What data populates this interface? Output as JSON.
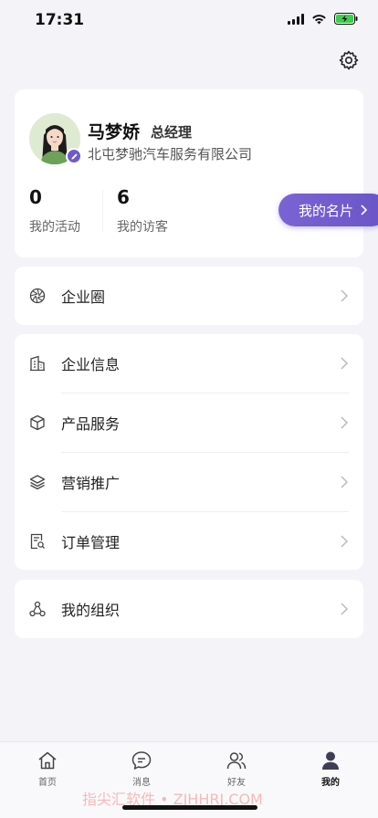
{
  "status": {
    "time": "17:31"
  },
  "profile": {
    "name": "马梦娇",
    "title": "总经理",
    "company": "北屯梦驰汽车服务有限公司",
    "stats": [
      {
        "value": "0",
        "label": "我的活动"
      },
      {
        "value": "6",
        "label": "我的访客"
      }
    ],
    "namecard_label": "我的名片"
  },
  "menus": {
    "group1": [
      {
        "label": "企业圈",
        "icon": "aperture-icon"
      }
    ],
    "group2": [
      {
        "label": "企业信息",
        "icon": "building-icon"
      },
      {
        "label": "产品服务",
        "icon": "cube-icon"
      },
      {
        "label": "营销推广",
        "icon": "layers-icon"
      },
      {
        "label": "订单管理",
        "icon": "order-search-icon"
      }
    ],
    "group3": [
      {
        "label": "我的组织",
        "icon": "org-nodes-icon"
      }
    ]
  },
  "tabbar": {
    "tabs": [
      {
        "label": "首页",
        "icon": "home-icon",
        "active": false
      },
      {
        "label": "消息",
        "icon": "chat-icon",
        "active": false
      },
      {
        "label": "好友",
        "icon": "friends-icon",
        "active": false
      },
      {
        "label": "我的",
        "icon": "person-icon",
        "active": true
      }
    ]
  },
  "watermark": "指尖汇软件 • ZJHHRJ.COM",
  "colors": {
    "accent": "#6e5bc9",
    "background": "#f4f4f8",
    "card": "#ffffff"
  }
}
